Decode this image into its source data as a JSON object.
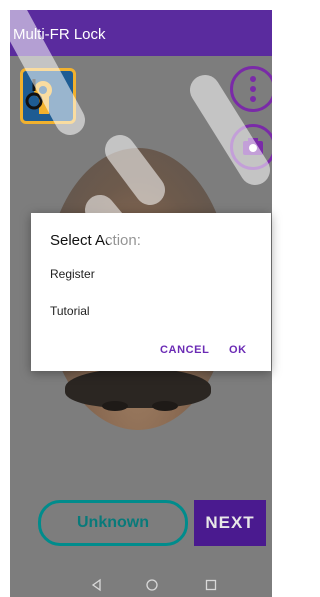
{
  "app": {
    "title": "Multi-FR Lock"
  },
  "controls": {
    "status_label": "Unknown",
    "next_label": "NEXT"
  },
  "dialog": {
    "title": "Select Action:",
    "items": [
      "Register",
      "Tutorial"
    ],
    "cancel_label": "CANCEL",
    "ok_label": "OK"
  },
  "icons": {
    "app_icon": "lock-key-icon",
    "menu": "more-vert-icon",
    "camera_switch": "camera-switch-icon",
    "nav_back": "back-triangle-icon",
    "nav_home": "home-circle-icon",
    "nav_recents": "recents-square-icon"
  },
  "colors": {
    "appbar": "#5a2b9e",
    "accent": "#6b2bb5",
    "status_outline": "#008c8c"
  }
}
